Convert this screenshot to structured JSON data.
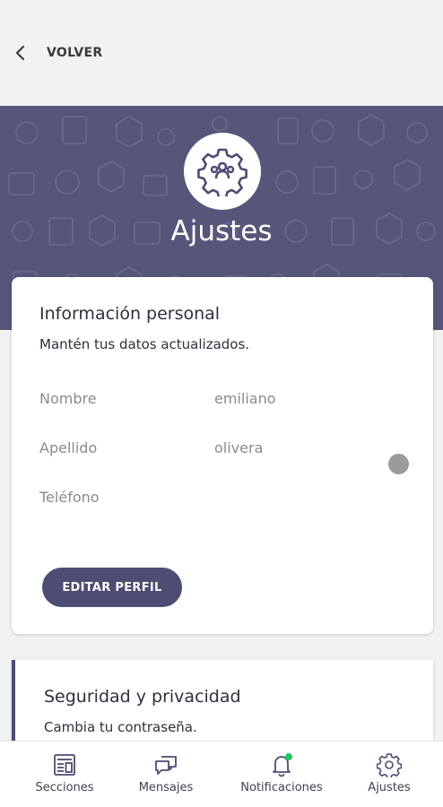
{
  "header": {
    "back_label": "VOLVER",
    "back_icon": "chevron-left-icon"
  },
  "banner": {
    "title": "Ajustes",
    "background_color": "#56557a",
    "avatar_icon": "gear-users-icon"
  },
  "personal_info": {
    "title": "Información personal",
    "subtitle": "Mantén tus datos actualizados.",
    "fields": [
      {
        "label": "Nombre",
        "value": "emiliano"
      },
      {
        "label": "Apellido",
        "value": "olivera"
      },
      {
        "label": "Teléfono",
        "value": ""
      }
    ],
    "edit_button_label": "EDITAR PERFIL",
    "accent_color": "#4d4c72"
  },
  "security": {
    "title": "Seguridad y privacidad",
    "subtitle": "Cambia tu contraseña."
  },
  "bottom_nav": {
    "items": [
      {
        "label": "Secciones",
        "icon": "sections-icon"
      },
      {
        "label": "Mensajes",
        "icon": "messages-icon"
      },
      {
        "label": "Notificaciones",
        "icon": "bell-icon",
        "badge_color": "#22c55e"
      },
      {
        "label": "Ajustes",
        "icon": "gear-icon"
      }
    ]
  }
}
